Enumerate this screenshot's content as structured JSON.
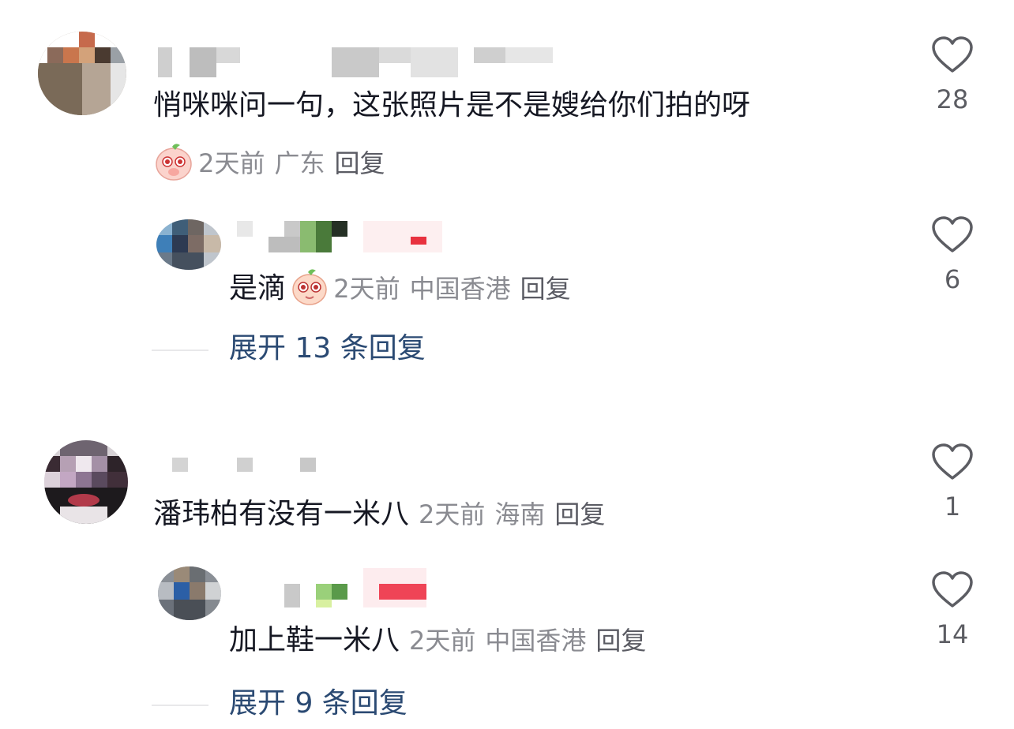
{
  "comments": [
    {
      "text": "悄咪咪问一句，这张照片是不是嫂给你们拍的呀",
      "time": "2天前",
      "region": "广东",
      "reply_label": "回复",
      "likes": "28"
    },
    {
      "text": "潘玮柏有没有一米八",
      "time": "2天前",
      "region": "海南",
      "reply_label": "回复",
      "likes": "1"
    }
  ],
  "replies": [
    {
      "text": "是滴",
      "time": "2天前",
      "region": "中国香港",
      "reply_label": "回复",
      "likes": "6",
      "expand_label": "展开 13 条回复"
    },
    {
      "text": "加上鞋一米八",
      "time": "2天前",
      "region": "中国香港",
      "reply_label": "回复",
      "likes": "14",
      "expand_label": "展开 9 条回复"
    }
  ],
  "icons": {
    "like": "heart-outline-icon",
    "emoji": "shy-sticker-emoji"
  },
  "colors": {
    "text": "#161823",
    "meta": "#8a8b91",
    "expand_link": "#2b4a73",
    "icon": "#5c5d63"
  }
}
